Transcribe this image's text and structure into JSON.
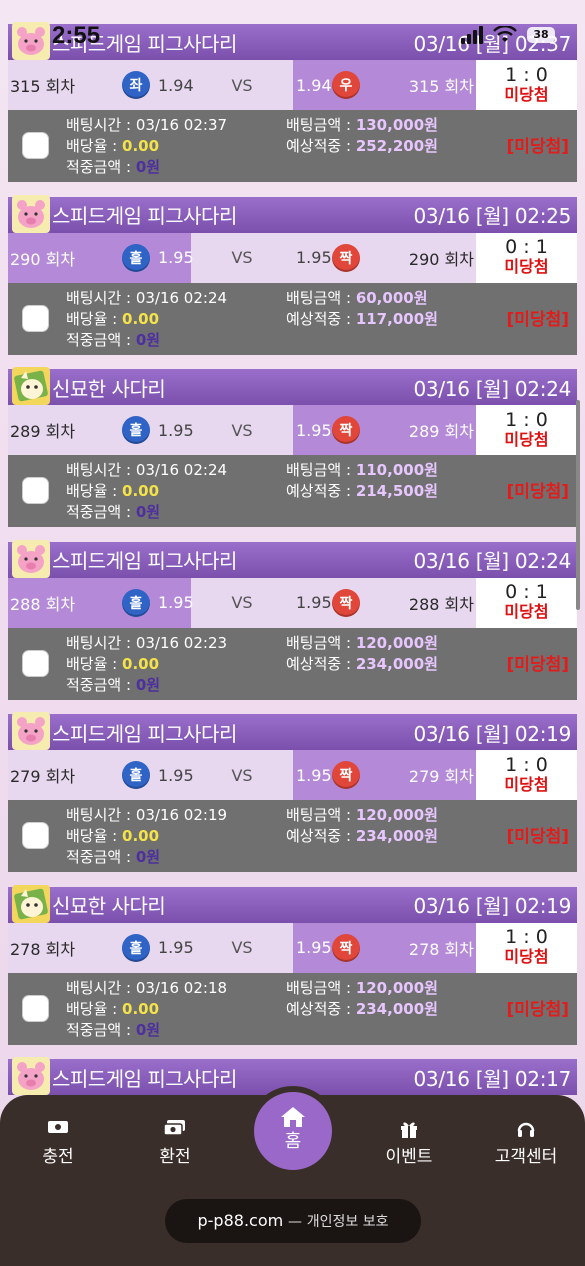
{
  "status_bar": {
    "time": "2:55",
    "battery": "38"
  },
  "cards": [
    {
      "game": "스피드게임 피그사다리",
      "avatar": "pig",
      "date": "03/16 [월] 02:37",
      "left": {
        "round": "315 회차",
        "pick": "좌",
        "pick_color": "blue",
        "odds": "1.94",
        "active": false
      },
      "vs": "VS",
      "right": {
        "round": "315 회차",
        "pick": "우",
        "pick_color": "red",
        "odds": "1.94",
        "active": true
      },
      "score": "1 : 0",
      "result": "미당첨",
      "bet_time_label": "배팅시간 :",
      "bet_time": "03/16 02:37",
      "rate_label": "배당율 :",
      "rate": "0.00",
      "win_label": "적중금액 :",
      "win": "0원",
      "amount_label": "배팅금액 :",
      "amount": "130,000원",
      "expected_label": "예상적중 :",
      "expected": "252,200원",
      "status": "[미당첨]"
    },
    {
      "game": "스피드게임 피그사다리",
      "avatar": "pig",
      "date": "03/16 [월] 02:25",
      "left": {
        "round": "290 회차",
        "pick": "홀",
        "pick_color": "blue",
        "odds": "1.95",
        "active": true
      },
      "vs": "VS",
      "right": {
        "round": "290 회차",
        "pick": "짝",
        "pick_color": "red",
        "odds": "1.95",
        "active": false
      },
      "score": "0 : 1",
      "result": "미당첨",
      "bet_time_label": "배팅시간 :",
      "bet_time": "03/16 02:24",
      "rate_label": "배당율 :",
      "rate": "0.00",
      "win_label": "적중금액 :",
      "win": "0원",
      "amount_label": "배팅금액 :",
      "amount": "60,000원",
      "expected_label": "예상적중 :",
      "expected": "117,000원",
      "status": "[미당첨]"
    },
    {
      "game": "신묘한 사다리",
      "avatar": "cat",
      "date": "03/16 [월] 02:24",
      "left": {
        "round": "289 회차",
        "pick": "홀",
        "pick_color": "blue",
        "odds": "1.95",
        "active": false
      },
      "vs": "VS",
      "right": {
        "round": "289 회차",
        "pick": "짝",
        "pick_color": "red",
        "odds": "1.95",
        "active": true
      },
      "score": "1 : 0",
      "result": "미당첨",
      "bet_time_label": "배팅시간 :",
      "bet_time": "03/16 02:24",
      "rate_label": "배당율 :",
      "rate": "0.00",
      "win_label": "적중금액 :",
      "win": "0원",
      "amount_label": "배팅금액 :",
      "amount": "110,000원",
      "expected_label": "예상적중 :",
      "expected": "214,500원",
      "status": "[미당첨]"
    },
    {
      "game": "스피드게임 피그사다리",
      "avatar": "pig",
      "date": "03/16 [월] 02:24",
      "left": {
        "round": "288 회차",
        "pick": "홀",
        "pick_color": "blue",
        "odds": "1.95",
        "active": true
      },
      "vs": "VS",
      "right": {
        "round": "288 회차",
        "pick": "짝",
        "pick_color": "red",
        "odds": "1.95",
        "active": false
      },
      "score": "0 : 1",
      "result": "미당첨",
      "bet_time_label": "배팅시간 :",
      "bet_time": "03/16 02:23",
      "rate_label": "배당율 :",
      "rate": "0.00",
      "win_label": "적중금액 :",
      "win": "0원",
      "amount_label": "배팅금액 :",
      "amount": "120,000원",
      "expected_label": "예상적중 :",
      "expected": "234,000원",
      "status": "[미당첨]"
    },
    {
      "game": "스피드게임 피그사다리",
      "avatar": "pig",
      "date": "03/16 [월] 02:19",
      "left": {
        "round": "279 회차",
        "pick": "홀",
        "pick_color": "blue",
        "odds": "1.95",
        "active": false
      },
      "vs": "VS",
      "right": {
        "round": "279 회차",
        "pick": "짝",
        "pick_color": "red",
        "odds": "1.95",
        "active": true
      },
      "score": "1 : 0",
      "result": "미당첨",
      "bet_time_label": "배팅시간 :",
      "bet_time": "03/16 02:19",
      "rate_label": "배당율 :",
      "rate": "0.00",
      "win_label": "적중금액 :",
      "win": "0원",
      "amount_label": "배팅금액 :",
      "amount": "120,000원",
      "expected_label": "예상적중 :",
      "expected": "234,000원",
      "status": "[미당첨]"
    },
    {
      "game": "신묘한 사다리",
      "avatar": "cat",
      "date": "03/16 [월] 02:19",
      "left": {
        "round": "278 회차",
        "pick": "홀",
        "pick_color": "blue",
        "odds": "1.95",
        "active": false
      },
      "vs": "VS",
      "right": {
        "round": "278 회차",
        "pick": "짝",
        "pick_color": "red",
        "odds": "1.95",
        "active": true
      },
      "score": "1 : 0",
      "result": "미당첨",
      "bet_time_label": "배팅시간 :",
      "bet_time": "03/16 02:18",
      "rate_label": "배당율 :",
      "rate": "0.00",
      "win_label": "적중금액 :",
      "win": "0원",
      "amount_label": "배팅금액 :",
      "amount": "120,000원",
      "expected_label": "예상적중 :",
      "expected": "234,000원",
      "status": "[미당첨]"
    },
    {
      "game": "스피드게임 피그사다리",
      "avatar": "pig",
      "date": "03/16 [월] 02:17"
    }
  ],
  "nav": {
    "charge": "충전",
    "exchange": "환전",
    "home": "홈",
    "event": "이벤트",
    "support": "고객센터"
  },
  "footer": {
    "domain": "p-p88.com",
    "separator": "—",
    "privacy": "개인정보 보호"
  },
  "colors": {
    "header_purple": "#7b50ad",
    "active_side": "#b48ad8",
    "bet_row": "#707070",
    "result_red": "#d11111",
    "pick_blue": "#2f63c6",
    "pick_red": "#e0463a"
  }
}
